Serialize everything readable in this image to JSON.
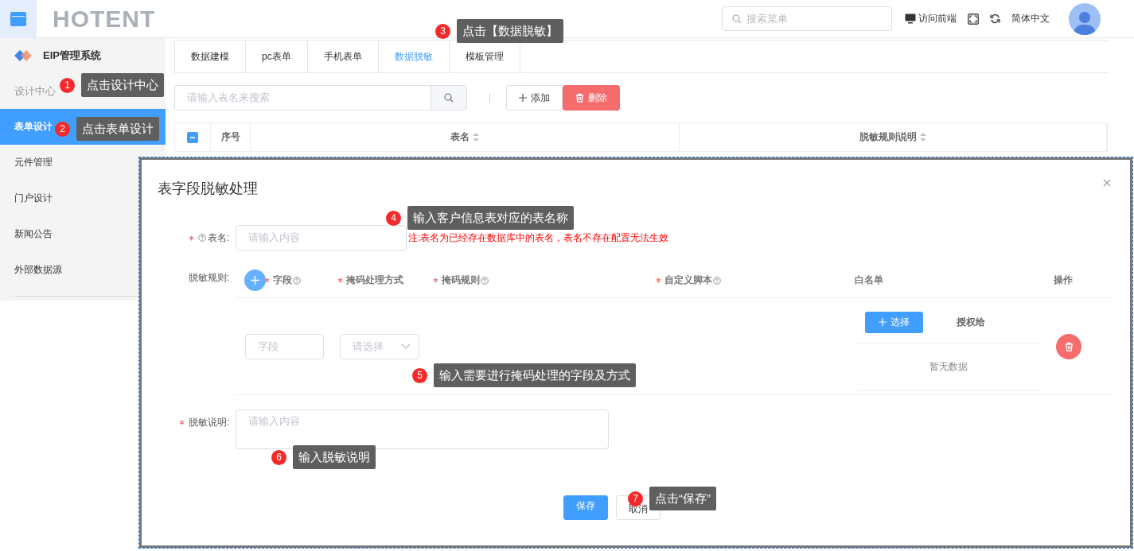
{
  "header": {
    "logo": "HOTENT",
    "search": {
      "placeholder": "搜索菜单"
    },
    "visit": "访问前端",
    "language": "简体中文"
  },
  "sidebar": {
    "title": "EIP管理系统",
    "items": [
      {
        "label": "设计中心",
        "kind": "heading",
        "selected": false
      },
      {
        "label": "表单设计",
        "kind": "item",
        "selected": true
      },
      {
        "label": "元件管理",
        "kind": "item",
        "selected": false
      },
      {
        "label": "门户设计",
        "kind": "item",
        "selected": false
      },
      {
        "label": "新闻公告",
        "kind": "item",
        "selected": false
      },
      {
        "label": "外部数据源",
        "kind": "item",
        "selected": false
      }
    ]
  },
  "tabs": [
    {
      "label": "数据建模",
      "selected": false
    },
    {
      "label": "pc表单",
      "selected": false
    },
    {
      "label": "手机表单",
      "selected": false
    },
    {
      "label": "数据脱敏",
      "selected": true
    },
    {
      "label": "模板管理",
      "selected": false
    }
  ],
  "toolbar": {
    "search": {
      "placeholder": "请输入表名来搜索"
    },
    "add": "添加",
    "delete": "删除"
  },
  "table": {
    "select_all": {
      "indeterminate": true
    },
    "columns": [
      "序号",
      "表名",
      "脱敏规则说明"
    ]
  },
  "dialog": {
    "title": "表字段脱敏处理",
    "table_name": {
      "label": "表名:",
      "required": true,
      "help": true,
      "placeholder": "请输入内容",
      "note": "注:表名为已经存在数据库中的表名，表名不存在配置无法生效"
    },
    "rules": {
      "label": "脱敏规则:",
      "columns": [
        {
          "label": "字段",
          "required": true,
          "help": true
        },
        {
          "label": "掩码处理方式",
          "required": true,
          "help": false
        },
        {
          "label": "掩码规则",
          "required": true,
          "help": true
        },
        {
          "label": "自定义脚本",
          "required": true,
          "help": true
        },
        {
          "label": "白名单",
          "required": false,
          "help": false
        },
        {
          "label": "操作",
          "required": false,
          "help": false
        }
      ],
      "row": {
        "field_placeholder": "字段",
        "select_placeholder": "请选择",
        "choose": "选择",
        "granted": "授权给",
        "empty": "暂无数据"
      }
    },
    "description": {
      "label": "脱敏说明:",
      "required": true,
      "placeholder": "请输入内容"
    },
    "save": "保存",
    "cancel": "取消"
  },
  "callouts": [
    {
      "number": "1",
      "text": "点击设计中心"
    },
    {
      "number": "2",
      "text": "点击表单设计"
    },
    {
      "number": "3",
      "text": "点击【数据脱敏】"
    },
    {
      "number": "4",
      "text": "输入客户信息表对应的表名称"
    },
    {
      "number": "5",
      "text": "输入需要进行掩码处理的字段及方式"
    },
    {
      "number": "6",
      "text": "输入脱敏说明"
    },
    {
      "number": "7",
      "text": "点击“保存”"
    }
  ]
}
